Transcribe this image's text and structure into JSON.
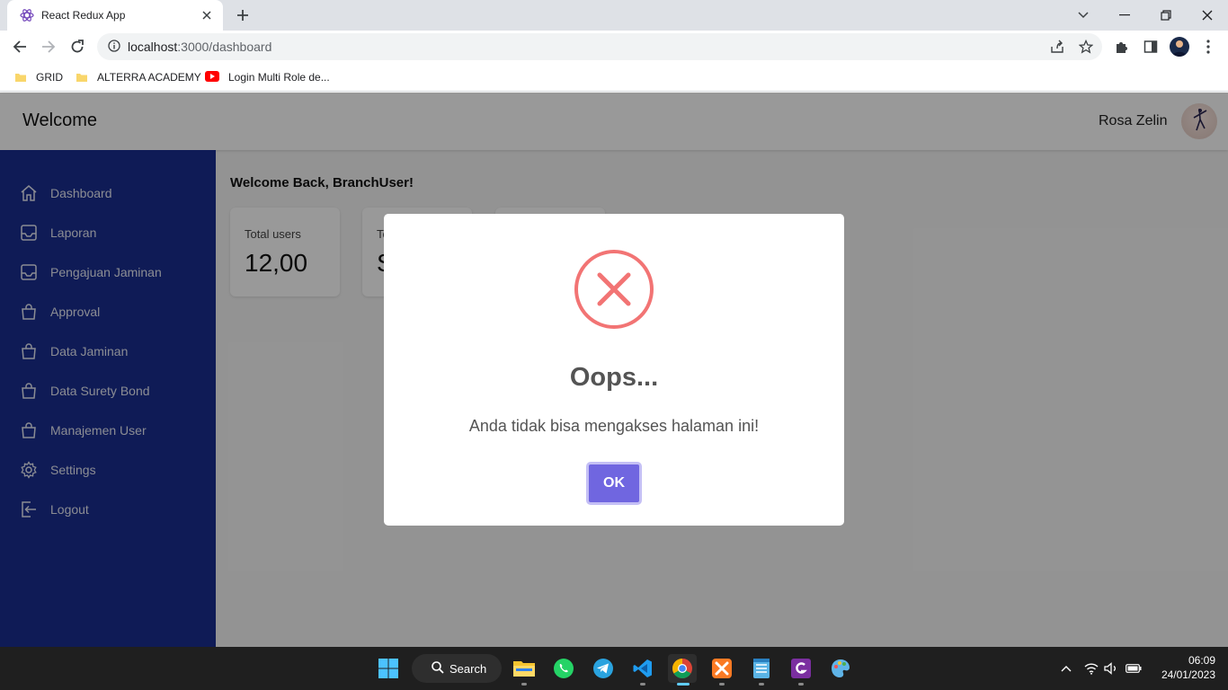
{
  "browser": {
    "tab_title": "React Redux App",
    "url_host": "localhost",
    "url_path": ":3000/dashboard",
    "bookmarks": [
      {
        "label": "GRID",
        "icon": "folder-icon"
      },
      {
        "label": "ALTERRA ACADEMY",
        "icon": "folder-icon"
      },
      {
        "label": "Login Multi Role de...",
        "icon": "youtube-icon"
      }
    ]
  },
  "header": {
    "brand": "Welcome",
    "user_name": "Rosa Zelin"
  },
  "sidebar": {
    "items": [
      {
        "label": "Dashboard",
        "icon": "home-icon"
      },
      {
        "label": "Laporan",
        "icon": "inbox-icon"
      },
      {
        "label": "Pengajuan Jaminan",
        "icon": "inbox-icon"
      },
      {
        "label": "Approval",
        "icon": "shopping-bag-icon"
      },
      {
        "label": "Data Jaminan",
        "icon": "shopping-bag-icon"
      },
      {
        "label": "Data Surety Bond",
        "icon": "shopping-bag-icon"
      },
      {
        "label": "Manajemen User",
        "icon": "shopping-bag-icon"
      },
      {
        "label": "Settings",
        "icon": "gear-icon"
      },
      {
        "label": "Logout",
        "icon": "logout-icon"
      }
    ]
  },
  "main": {
    "welcome": "Welcome Back, BranchUser!",
    "cards": [
      {
        "label": "Total users",
        "value": "12,00"
      },
      {
        "label": "To",
        "value": "S"
      },
      {
        "label": "",
        "value": ""
      }
    ]
  },
  "modal": {
    "title": "Oops...",
    "message": "Anda tidak bisa mengakses halaman ini!",
    "ok_label": "OK",
    "icon": "error-x-icon",
    "icon_color": "#f27474",
    "button_color": "#7066e0"
  },
  "taskbar": {
    "search_label": "Search",
    "time": "06:09",
    "date": "24/01/2023"
  },
  "colors": {
    "sidebar_bg": "#1a2d8f",
    "overlay": "rgba(0,0,0,0.4)"
  }
}
